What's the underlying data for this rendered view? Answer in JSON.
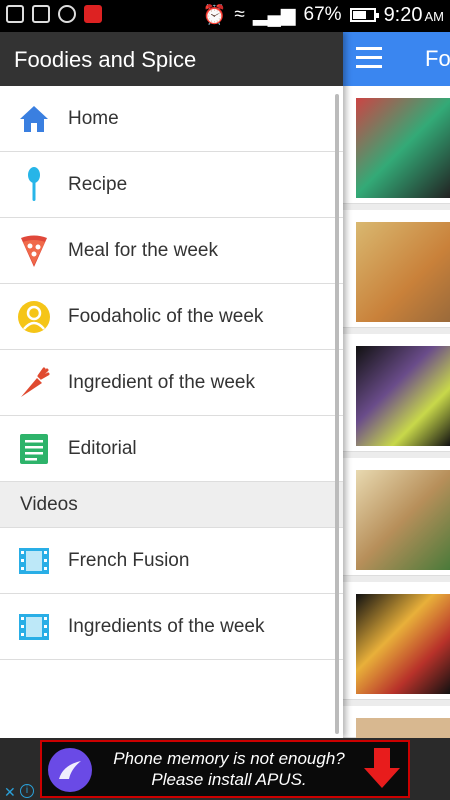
{
  "status_bar": {
    "battery": "67%",
    "battery_level": 0.67,
    "time": "9:20",
    "ampm": "AM"
  },
  "drawer": {
    "title": "Foodies and Spice",
    "items": [
      {
        "label": "Home",
        "icon": "home-icon"
      },
      {
        "label": "Recipe",
        "icon": "spoon-icon"
      },
      {
        "label": "Meal for the week",
        "icon": "pizza-icon"
      },
      {
        "label": "Foodaholic of the week",
        "icon": "user-icon"
      },
      {
        "label": "Ingredient of the week",
        "icon": "carrot-icon"
      },
      {
        "label": "Editorial",
        "icon": "document-icon"
      }
    ],
    "section_title": "Videos",
    "video_items": [
      {
        "label": "French Fusion",
        "icon": "film-icon"
      },
      {
        "label": "Ingredients of the week",
        "icon": "film-icon"
      }
    ]
  },
  "background_app": {
    "title": "Fo"
  },
  "ad": {
    "line1": "Phone memory is not enough?",
    "line2": "Please install APUS.",
    "colors": {
      "logo": "#6a4ae6",
      "arrow": "#e81c1c"
    }
  },
  "colors": {
    "toolbar": "#3a86f0",
    "drawer_header": "#333333"
  }
}
